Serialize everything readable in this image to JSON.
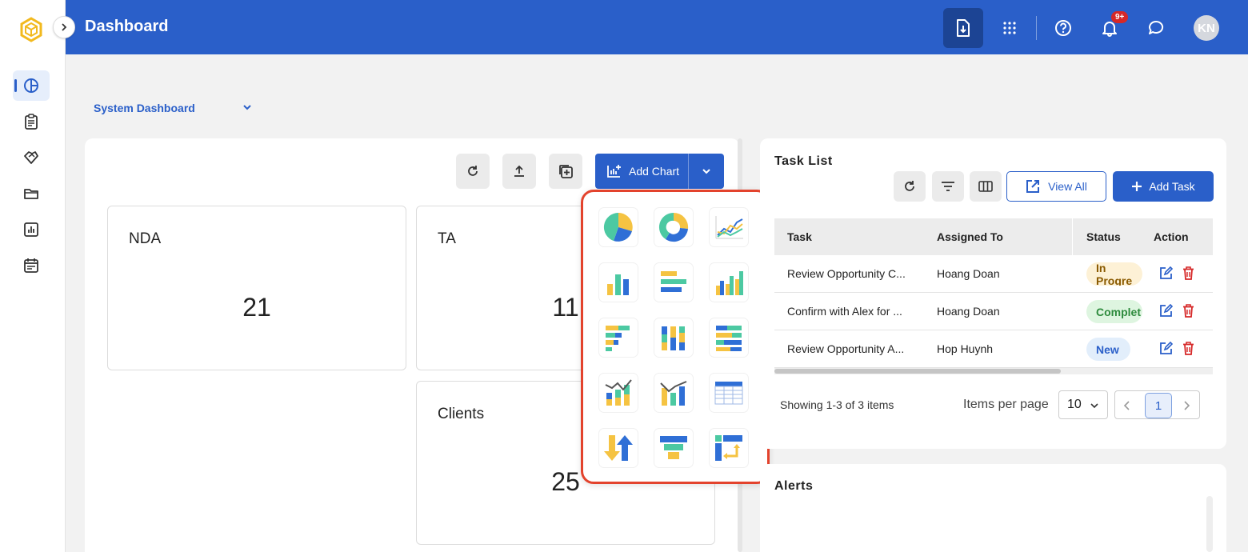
{
  "header": {
    "title": "Dashboard",
    "notification_count": "9+",
    "avatar_initials": "KN",
    "accent_color": "#2a5fc9"
  },
  "sidebar": {
    "items": [
      {
        "name": "dashboard",
        "icon": "pie-chart-icon",
        "active": true
      },
      {
        "name": "documents",
        "icon": "clipboard-icon"
      },
      {
        "name": "deals",
        "icon": "handshake-icon"
      },
      {
        "name": "folders",
        "icon": "folder-icon"
      },
      {
        "name": "reports",
        "icon": "bar-report-icon"
      },
      {
        "name": "calendar",
        "icon": "calendar-icon"
      }
    ]
  },
  "dashboard": {
    "selector_label": "System Dashboard",
    "add_chart_label": "Add Chart",
    "cards": [
      {
        "title": "NDA",
        "value": "21"
      },
      {
        "title": "TA",
        "value": "11"
      },
      {
        "title": "Clients",
        "value": "25"
      }
    ],
    "chart_menu": {
      "options": [
        "pie-chart-icon",
        "donut-chart-icon",
        "line-chart-icon",
        "bar-chart-icon",
        "horizontal-bar-chart-icon",
        "grouped-bar-chart-icon",
        "stacked-horizontal-bar-icon",
        "stacked-column-icon",
        "stacked-100-horizontal-icon",
        "combo-stacked-line-icon",
        "combo-bar-line-icon",
        "table-chart-icon",
        "sort-arrows-icon",
        "funnel-chart-icon",
        "pivot-table-icon"
      ]
    }
  },
  "tasks": {
    "title": "Task List",
    "view_all_label": "View All",
    "add_task_label": "Add Task",
    "columns": [
      "Task",
      "Assigned To",
      "Status",
      "Action"
    ],
    "rows": [
      {
        "task": "Review Opportunity C...",
        "assigned": "Hoang Doan",
        "status": "In Progre",
        "status_color": "#8a5a00",
        "status_bg": "#fdf1d6"
      },
      {
        "task": "Confirm with Alex for ...",
        "assigned": "Hoang Doan",
        "status": "Complet",
        "status_color": "#2e8b3d",
        "status_bg": "#def5e0"
      },
      {
        "task": "Review Opportunity A...",
        "assigned": "Hop Huynh",
        "status": "New",
        "status_color": "#2a5fc9",
        "status_bg": "#e2eefb"
      }
    ],
    "showing": "Showing 1-3 of 3 items",
    "items_per_page_label": "Items per page",
    "items_per_page": "10",
    "current_page": "1"
  },
  "alerts": {
    "title": "Alerts"
  }
}
